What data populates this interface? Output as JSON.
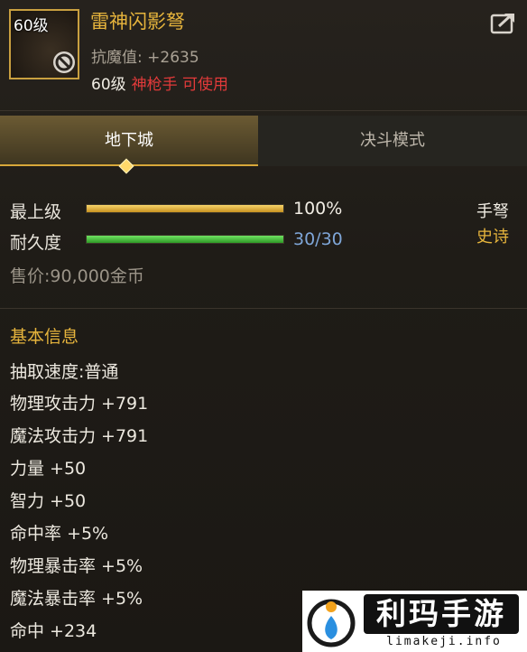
{
  "item": {
    "level_badge": "60级",
    "name": "雷神闪影弩",
    "magic_resist_label": "抗魔值:",
    "magic_resist_value": "+2635",
    "requirement_level": "60级",
    "requirement_job": "神枪手 可使用"
  },
  "tabs": [
    {
      "label": "地下城",
      "active": true
    },
    {
      "label": "决斗模式",
      "active": false
    }
  ],
  "stats": {
    "grade_label": "最上级",
    "grade_value": "100%",
    "grade_fraction": 1.0,
    "durability_label": "耐久度",
    "durability_value": "30/30",
    "durability_fraction": 1.0,
    "weapon_type": "手弩",
    "rarity": "史诗",
    "price": "售价:90,000金币"
  },
  "basic_info": {
    "title": "基本信息",
    "attributes": [
      "抽取速度:普通",
      "物理攻击力 +791",
      "魔法攻击力 +791",
      "力量 +50",
      "智力 +50",
      "命中率 +5%",
      "物理暴击率 +5%",
      "魔法暴击率 +5%",
      "命中 +234"
    ]
  },
  "watermark": {
    "brand": "利玛手游",
    "url": "limakeji.info"
  },
  "colors": {
    "gold": "#e6b43c",
    "red": "#e23a3a",
    "green_bar": "#4cc23e",
    "gold_bar": "#e8b83a",
    "blue_value": "#7fa6d8"
  },
  "icons": [
    "forbidden-icon",
    "share-icon",
    "diamond-icon",
    "watermark-logo"
  ]
}
